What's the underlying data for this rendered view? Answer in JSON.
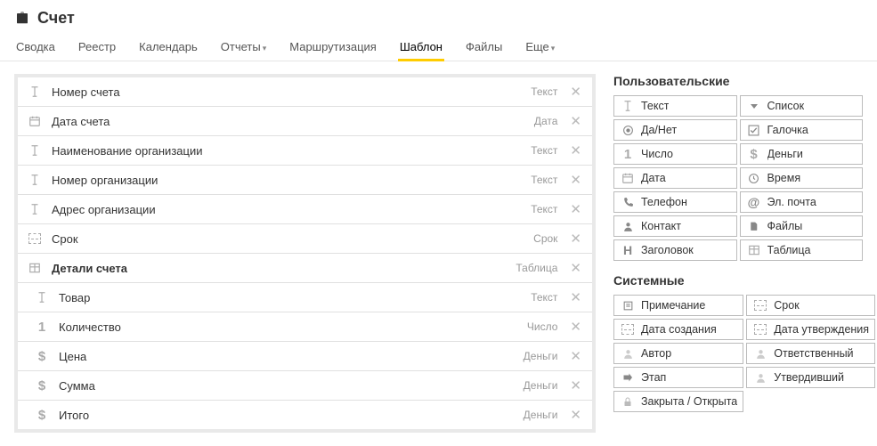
{
  "header": {
    "title": "Счет"
  },
  "tabs": [
    {
      "label": "Сводка",
      "active": false,
      "dropdown": false
    },
    {
      "label": "Реестр",
      "active": false,
      "dropdown": false
    },
    {
      "label": "Календарь",
      "active": false,
      "dropdown": false
    },
    {
      "label": "Отчеты",
      "active": false,
      "dropdown": true
    },
    {
      "label": "Маршрутизация",
      "active": false,
      "dropdown": false
    },
    {
      "label": "Шаблон",
      "active": true,
      "dropdown": false
    },
    {
      "label": "Файлы",
      "active": false,
      "dropdown": false
    },
    {
      "label": "Еще",
      "active": false,
      "dropdown": true
    }
  ],
  "fields": [
    {
      "icon": "text",
      "label": "Номер счета",
      "type": "Текст",
      "nested": false,
      "bold": false
    },
    {
      "icon": "calendar",
      "label": "Дата счета",
      "type": "Дата",
      "nested": false,
      "bold": false
    },
    {
      "icon": "text",
      "label": "Наименование организации",
      "type": "Текст",
      "nested": false,
      "bold": false
    },
    {
      "icon": "text",
      "label": "Номер организации",
      "type": "Текст",
      "nested": false,
      "bold": false
    },
    {
      "icon": "text",
      "label": "Адрес организации",
      "type": "Текст",
      "nested": false,
      "bold": false
    },
    {
      "icon": "dotted",
      "label": "Срок",
      "type": "Срок",
      "nested": false,
      "bold": false
    },
    {
      "icon": "table",
      "label": "Детали счета",
      "type": "Таблица",
      "nested": false,
      "bold": true
    },
    {
      "icon": "text",
      "label": "Товар",
      "type": "Текст",
      "nested": true,
      "bold": false
    },
    {
      "icon": "number",
      "label": "Количество",
      "type": "Число",
      "nested": true,
      "bold": false
    },
    {
      "icon": "money",
      "label": "Цена",
      "type": "Деньги",
      "nested": true,
      "bold": false
    },
    {
      "icon": "money",
      "label": "Сумма",
      "type": "Деньги",
      "nested": true,
      "bold": false
    },
    {
      "icon": "money",
      "label": "Итого",
      "type": "Деньги",
      "nested": true,
      "bold": false
    }
  ],
  "palette": {
    "user_title": "Пользовательские",
    "user_items": [
      {
        "icon": "text",
        "label": "Текст"
      },
      {
        "icon": "list",
        "label": "Список"
      },
      {
        "icon": "radio",
        "label": "Да/Нет"
      },
      {
        "icon": "check",
        "label": "Галочка"
      },
      {
        "icon": "number",
        "label": "Число"
      },
      {
        "icon": "money",
        "label": "Деньги"
      },
      {
        "icon": "calendar",
        "label": "Дата"
      },
      {
        "icon": "clock",
        "label": "Время"
      },
      {
        "icon": "phone",
        "label": "Телефон"
      },
      {
        "icon": "email",
        "label": "Эл. почта"
      },
      {
        "icon": "person",
        "label": "Контакт"
      },
      {
        "icon": "files",
        "label": "Файлы"
      },
      {
        "icon": "header",
        "label": "Заголовок"
      },
      {
        "icon": "table",
        "label": "Таблица"
      }
    ],
    "system_title": "Системные",
    "system_items": [
      {
        "icon": "note",
        "label": "Примечание"
      },
      {
        "icon": "dotted",
        "label": "Срок"
      },
      {
        "icon": "dotted",
        "label": "Дата создания"
      },
      {
        "icon": "dotted",
        "label": "Дата утверждения"
      },
      {
        "icon": "person-g",
        "label": "Автор"
      },
      {
        "icon": "person-g",
        "label": "Ответственный"
      },
      {
        "icon": "arrow",
        "label": "Этап"
      },
      {
        "icon": "person-g",
        "label": "Утвердивший"
      },
      {
        "icon": "lock",
        "label": "Закрыта / Открыта"
      }
    ]
  }
}
